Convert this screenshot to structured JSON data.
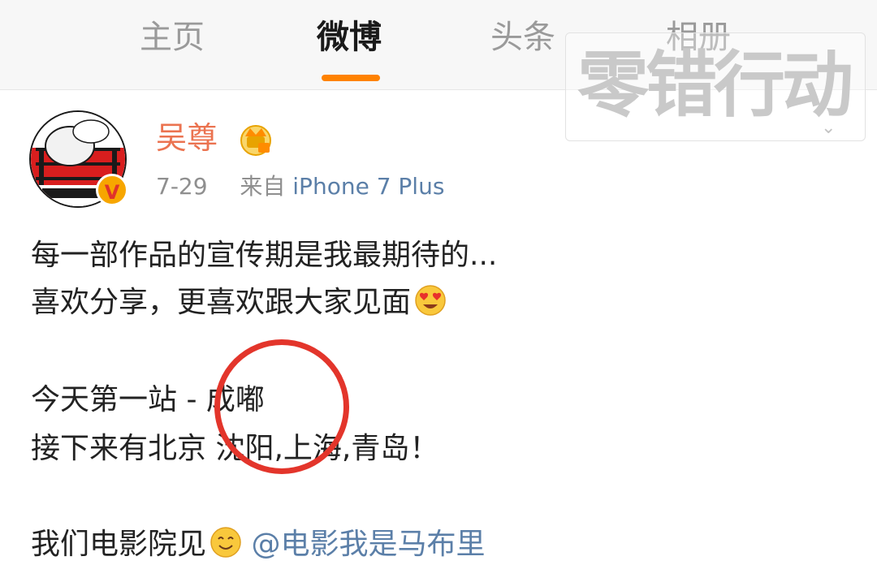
{
  "tabs": [
    {
      "label": "主页"
    },
    {
      "label": "微博"
    },
    {
      "label": "头条"
    },
    {
      "label": "相册"
    }
  ],
  "watermark": {
    "text": "零错行动"
  },
  "post": {
    "author": "吴尊",
    "date": "7-29",
    "source_prefix": "来自",
    "source": "iPhone 7 Plus",
    "lines": [
      "每一部作品的宣传期是我最期待的...",
      "喜欢分享，更喜欢跟大家见面",
      "今天第一站 - 成嘟",
      "接下来有北京 沈阳,上海,青岛！",
      "我们电影院见"
    ],
    "mention": "@电影我是马布里"
  },
  "colors": {
    "accent": "#ff8200",
    "username": "#eb7350",
    "link": "#5b7fa8",
    "annotation": "#e3352b"
  },
  "icons": {
    "verified": "verified-v-icon",
    "member": "crown-member-icon",
    "emoji_love": "heart-eyes-emoji",
    "emoji_smile": "smile-emoji"
  }
}
